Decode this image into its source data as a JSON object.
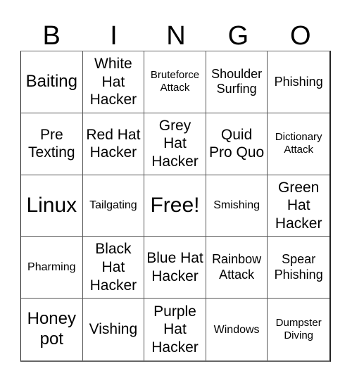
{
  "header": {
    "letters": [
      "B",
      "I",
      "N",
      "G",
      "O"
    ]
  },
  "grid": {
    "cells": [
      "Baiting",
      "White Hat Hacker",
      "Bruteforce Attack",
      "Shoulder Surfing",
      "Phishing",
      "Pre Texting",
      "Red Hat Hacker",
      "Grey Hat Hacker",
      "Quid Pro Quo",
      "Dictionary Attack",
      "Linux",
      "Tailgating",
      "Free!",
      "Smishing",
      "Green Hat Hacker",
      "Pharming",
      "Black Hat Hacker",
      "Blue Hat Hacker",
      "Rainbow Attack",
      "Spear Phishing",
      "Honey pot",
      "Vishing",
      "Purple Hat Hacker",
      "Windows",
      "Dumpster Diving"
    ]
  }
}
